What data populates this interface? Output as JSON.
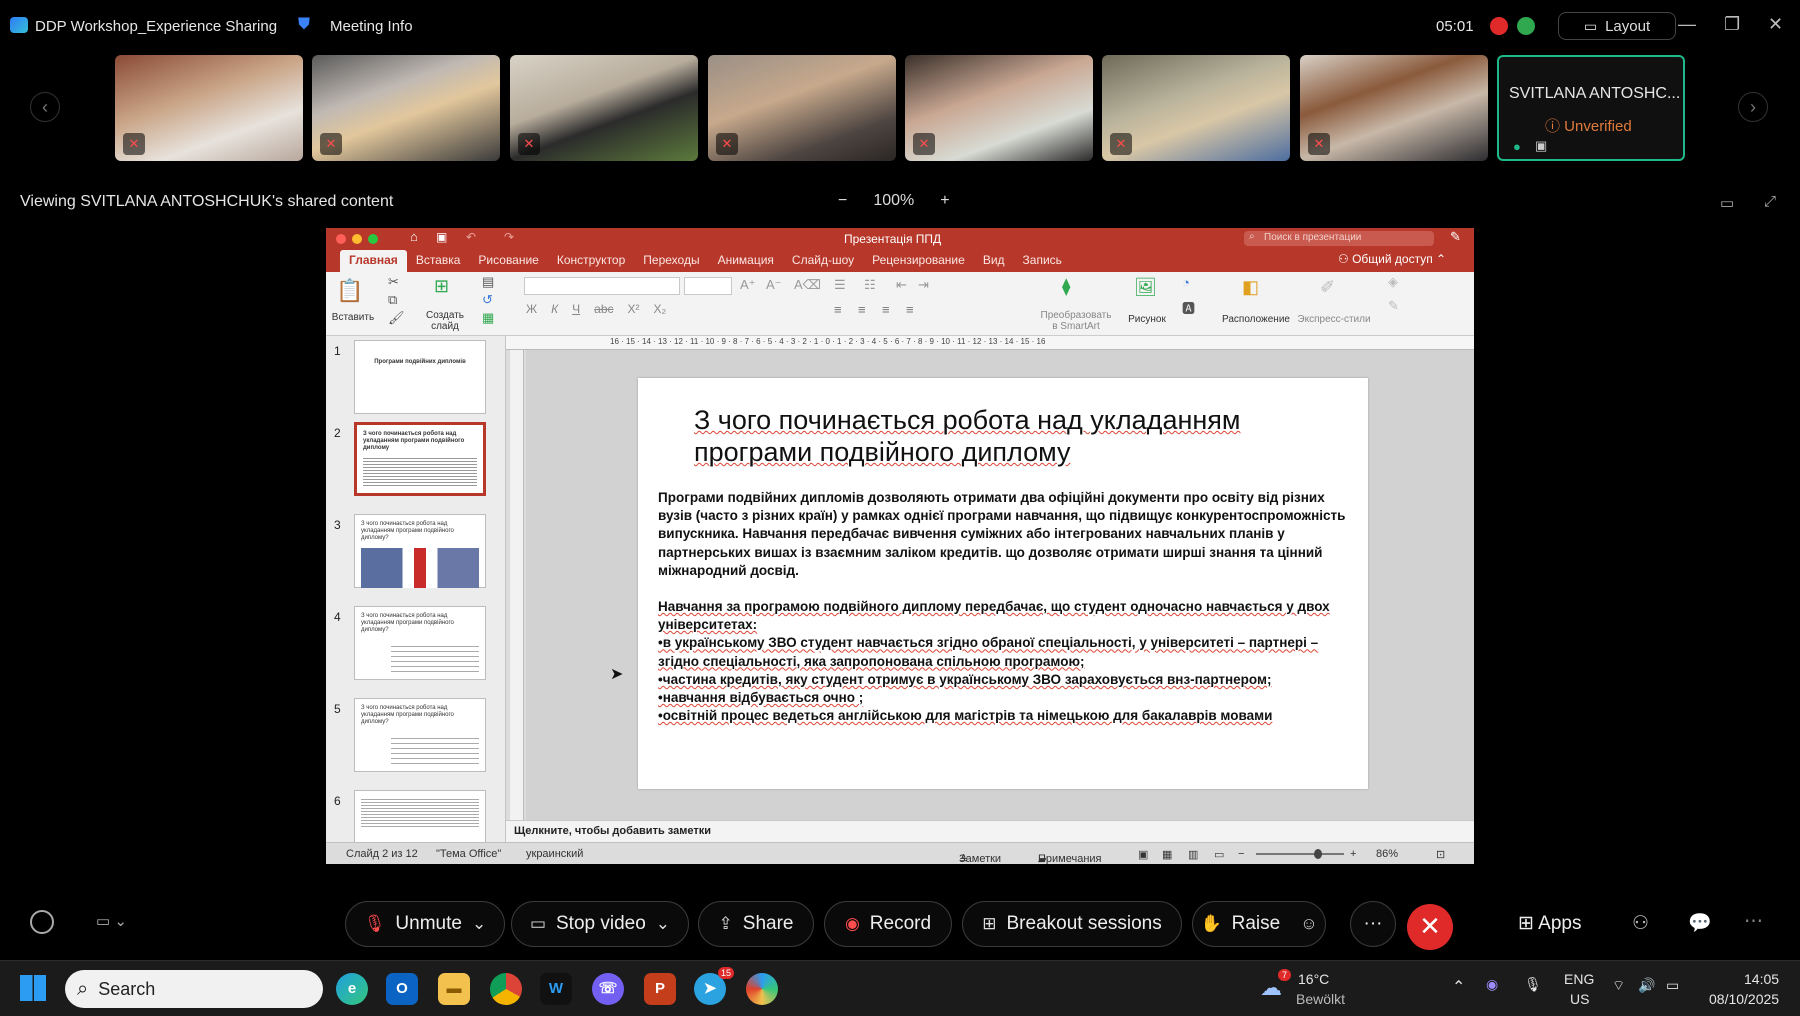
{
  "titlebar": {
    "meeting_title": "DDP Workshop_Experience Sharing",
    "meeting_info": "Meeting Info",
    "timer": "05:01",
    "layout_label": "Layout"
  },
  "participants": {
    "self_name": "SVITLANA ANTOSHC...",
    "self_status": "Unverified"
  },
  "share_bar": {
    "viewing_text": "Viewing SVITLANA ANTOSHCHUK's shared content",
    "zoom": "100%"
  },
  "ppt": {
    "window_title": "Презентація ППД",
    "search_placeholder": "Поиск в презентации",
    "tabs": [
      "Главная",
      "Вставка",
      "Рисование",
      "Конструктор",
      "Переходы",
      "Анимация",
      "Слайд-шоу",
      "Рецензирование",
      "Вид",
      "Запись"
    ],
    "share_label": "Общий доступ",
    "ribbon": {
      "paste": "Вставить",
      "new_slide_1": "Создать",
      "new_slide_2": "слайд",
      "smartart_1": "Преобразовать",
      "smartart_2": "в SmartArt",
      "picture": "Рисунок",
      "arrange": "Расположение",
      "quick_styles": "Экспресс-стили",
      "font_letters": [
        "Ж",
        "К",
        "Ч",
        "abc",
        "X²",
        "X₂"
      ]
    },
    "ruler_text": "16 · 15 · 14 · 13 · 12 · 11 · 10 · 9 · 8 · 7 · 6 · 5 · 4 · 3 · 2 · 1 · 0 · 1 · 2 · 3 · 4 · 5 · 6 · 7 · 8 · 9 · 10 · 11 · 12 · 13 · 14 · 15 · 16",
    "thumbnails": [
      {
        "num": "1",
        "text": "Програми подвійних дипломів"
      },
      {
        "num": "2",
        "text": "З чого починається робота над укладанням програми подвійного диплому"
      },
      {
        "num": "3",
        "text": "З чого починається робота над укладанням програми подвійного диплому?"
      },
      {
        "num": "4",
        "text": "З чого починається робота над укладанням програми подвійного диплому?"
      },
      {
        "num": "5",
        "text": "З чого починається робота над укладанням програми подвійного диплому?"
      },
      {
        "num": "6",
        "text": ""
      }
    ],
    "slide": {
      "title": "З чого починається робота над укладанням програми подвійного диплому",
      "paragraph": "Програми подвійних дипломів дозволяють отримати два офіційні документи про освіту від різних вузів (часто з різних країн) у рамках однієї програми навчання, що підвищує конкурентоспроможність випускника. Навчання передбачає вивчення суміжних або інтегрованих навчальних планів у партнерських вишах із взаємним заліком кредитів. що дозволяє отримати ширші знання та цінний міжнародний досвід.",
      "list": [
        "Навчання за програмою подвійного диплому передбачає, що студент одночасно навчається у двох університетах:",
        "•в українському ЗВО студент навчається згідно обраної спеціальності, у університеті – партнері – згідно спеціальності, яка запропонована спільною програмою;",
        "•частина кредитів, яку студент отримує в українському ЗВО зараховується внз-партнером;",
        "•навчання відбувається очно ;",
        "•освітній процес ведеться англійською для магістрів та німецькою для бакалаврів мовами"
      ]
    },
    "notes_placeholder": "Щелкните, чтобы добавить заметки",
    "status": {
      "slide_of": "Слайд 2 из 12",
      "theme": "\"Тема Office\"",
      "language": "украинский",
      "notes_btn": "Заметки",
      "comments_btn": "Примечания",
      "zoom": "86%"
    }
  },
  "controls": {
    "unmute": "Unmute",
    "stop_video": "Stop video",
    "share": "Share",
    "record": "Record",
    "breakout": "Breakout sessions",
    "raise": "Raise",
    "more": "···",
    "apps": "Apps"
  },
  "taskbar": {
    "search": "Search",
    "weather_temp": "16°C",
    "weather_desc": "Bewölkt",
    "weather_badge": "7",
    "telegram_badge": "15",
    "lang_1": "ENG",
    "lang_2": "US",
    "time": "14:05",
    "date": "08/10/2025"
  },
  "colors": {
    "ppt_accent": "#b7372a",
    "self_border": "#1fb88a",
    "end_button": "#e02a2a",
    "unverified": "#e07a3a"
  }
}
